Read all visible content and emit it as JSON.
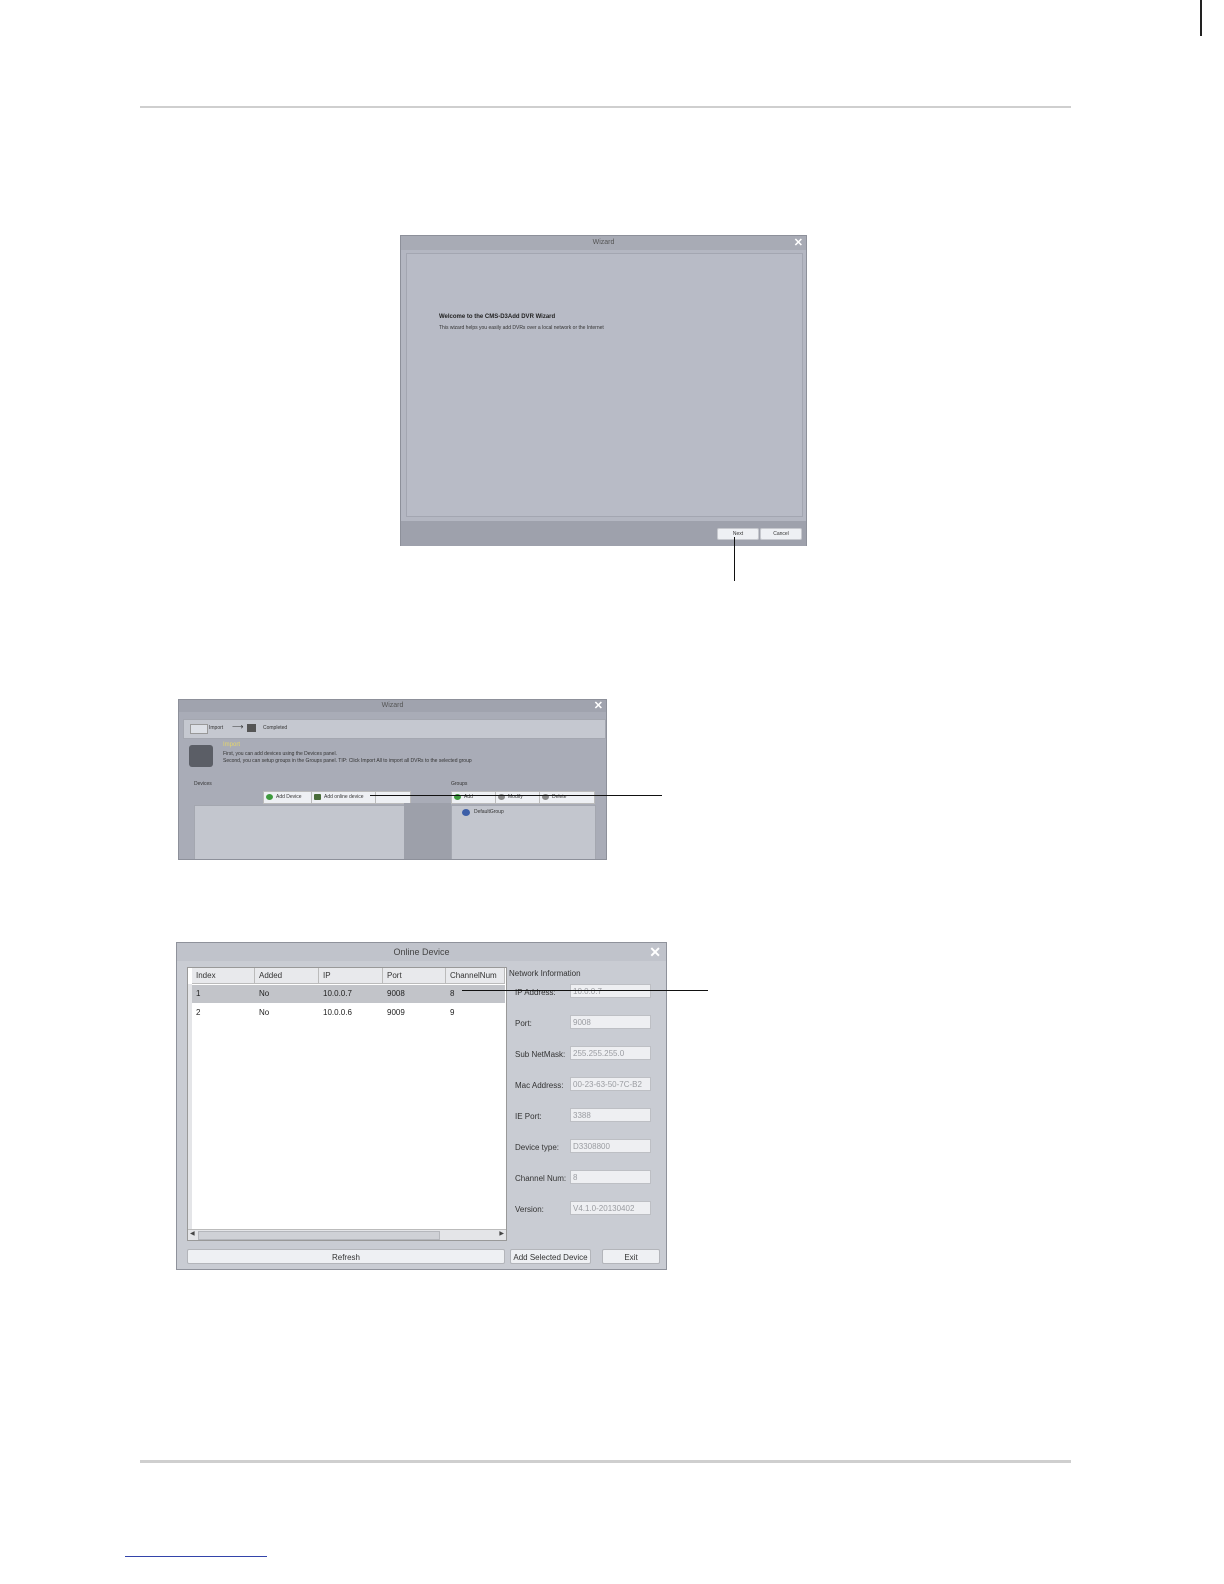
{
  "wizard1": {
    "title": "Wizard",
    "heading": "Welcome to the CMS-D3Add DVR Wizard",
    "subtitle": "This wizard helps you easily add DVRs over a local network or the Internet",
    "next_label": "Next",
    "cancel_label": "Cancel"
  },
  "wizard2": {
    "title": "Wizard",
    "step1": "Import",
    "step2": "Completed",
    "step2_num": "2",
    "import_title": "Import",
    "import_line1": "First, you can add devices using the Devices panel.",
    "import_line2": "Second, you can setup groups in the Groups panel. TIP: Click Import All to import all DVRs to the selected group",
    "devices_label": "Devices",
    "groups_label": "Groups",
    "add_device_label": "Add Device",
    "add_online_device_label": "Add online device",
    "group_btn1": "Add",
    "group_btn2": "Modify",
    "group_btn3": "Delete",
    "default_group": "DefaultGroup"
  },
  "online_device": {
    "title": "Online Device",
    "columns": [
      "Index",
      "Added",
      "IP",
      "Port",
      "ChannelNum"
    ],
    "rows": [
      [
        "1",
        "No",
        "10.0.0.7",
        "9008",
        "8"
      ],
      [
        "2",
        "No",
        "10.0.0.6",
        "9009",
        "9"
      ]
    ],
    "network_info_title": "Network Information",
    "fields": [
      {
        "label": "IP Address:",
        "value": "10.0.0.7"
      },
      {
        "label": "Port:",
        "value": "9008"
      },
      {
        "label": "Sub NetMask:",
        "value": "255.255.255.0"
      },
      {
        "label": "Mac Address:",
        "value": "00-23-63-50-7C-B2"
      },
      {
        "label": "IE Port:",
        "value": "3388"
      },
      {
        "label": "Device type:",
        "value": "D3308800"
      },
      {
        "label": "Channel Num:",
        "value": "8"
      },
      {
        "label": "Version:",
        "value": "V4.1.0-20130402"
      }
    ],
    "refresh_label": "Refresh",
    "add_selected_label": "Add Selected Device",
    "exit_label": "Exit"
  }
}
